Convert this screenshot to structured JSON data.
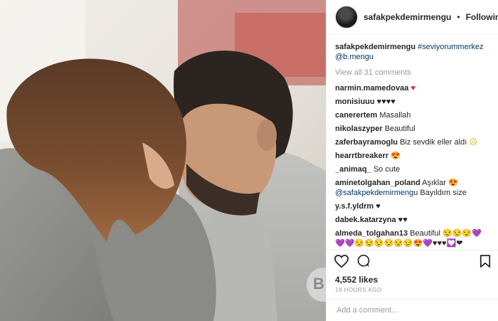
{
  "post": {
    "username": "safakpekdemirmengu",
    "separator": "•",
    "follow_label": "Following",
    "caption_user": "safakpekdemirmengu",
    "caption_hashtag": "#seviyorummerkez",
    "caption_mention": "@b.mengu",
    "view_all": "View all 31 comments",
    "likes": "4,552 likes",
    "time": "18 HOURS AGO",
    "add_comment_placeholder": "Add a comment...",
    "watermark": "B"
  },
  "comments": [
    {
      "user": "narmin.mamedovaa",
      "text": "",
      "emoji": "♥"
    },
    {
      "user": "monisiuuu",
      "text": "",
      "emoji": "♥♥♥♥"
    },
    {
      "user": "canerertem",
      "text": "Masallah",
      "emoji": ""
    },
    {
      "user": "nikolaszyper",
      "text": "Beautiful",
      "emoji": ""
    },
    {
      "user": "zaferbayramoglu",
      "text": "Biz sevdik eller aldı",
      "emoji": "☹"
    },
    {
      "user": "hearrtbreakerr",
      "text": "",
      "emoji": "😍"
    },
    {
      "user": "_animaq_",
      "text": "So cute",
      "emoji": ""
    },
    {
      "user": "aminetolgahan_poland",
      "text": "Aşıklar",
      "emoji": "😍",
      "mention": "@safakpekdemirmengu",
      "text2": "Bayıldım size"
    },
    {
      "user": "y.s.f.yldrm",
      "text": "",
      "emoji": "♥"
    },
    {
      "user": "dabek.katarzyna",
      "text": "",
      "emoji": "♥♥"
    },
    {
      "user": "almeda_tolgahan13",
      "text": "Beautiful",
      "emoji": "😒😒😒💜💜💜😒😒😒😒😒😒😍💜♥♥♥💟❤"
    }
  ]
}
